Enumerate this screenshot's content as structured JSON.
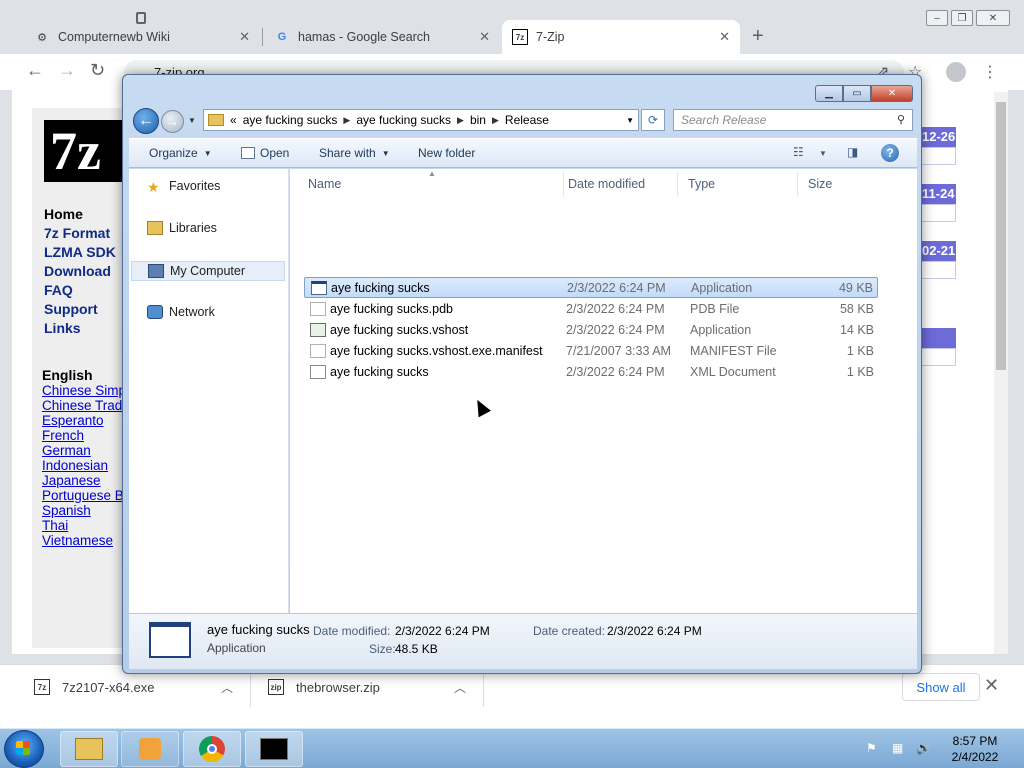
{
  "chrome": {
    "tabs": [
      {
        "label": "Computernewb Wiki",
        "icon": "puzzle-icon"
      },
      {
        "label": "hamas - Google Search",
        "icon": "google-icon"
      },
      {
        "label": "7-Zip",
        "icon": "7zip-icon"
      }
    ],
    "url": "7-zip.org",
    "window_buttons": {
      "minimize": "–",
      "maximize": "❐",
      "close": "✕"
    }
  },
  "site": {
    "logo": "7z",
    "nav": [
      "Home",
      "7z Format",
      "LZMA SDK",
      "Download",
      "FAQ",
      "Support",
      "Links"
    ],
    "language_heading": "English",
    "languages": [
      "Chinese Simp",
      "Chinese Trad",
      "Esperanto",
      "French",
      "German",
      "Indonesian",
      "Japanese",
      "Portuguese Br",
      "Spanish",
      "Thai",
      "Vietnamese"
    ],
    "date_badges": [
      "12-26",
      "11-24",
      "02-21"
    ]
  },
  "downloads": {
    "items": [
      {
        "name": "7z2107-x64.exe"
      },
      {
        "name": "thebrowser.zip"
      }
    ],
    "show_all": "Show all"
  },
  "explorer": {
    "breadcrumb": [
      "«",
      "aye fucking sucks",
      "aye fucking sucks",
      "bin",
      "Release"
    ],
    "search_placeholder": "Search Release",
    "commands": {
      "organize": "Organize",
      "open": "Open",
      "share_with": "Share with",
      "new_folder": "New folder"
    },
    "nav": [
      {
        "label": "Favorites",
        "icon": "star-icon"
      },
      {
        "label": "Libraries",
        "icon": "libraries-icon"
      },
      {
        "label": "My Computer",
        "icon": "computer-icon"
      },
      {
        "label": "Network",
        "icon": "network-icon"
      }
    ],
    "columns": {
      "name": "Name",
      "date": "Date modified",
      "type": "Type",
      "size": "Size"
    },
    "files": [
      {
        "name": "aye fucking sucks",
        "date": "2/3/2022 6:24 PM",
        "type": "Application",
        "size": "49 KB",
        "selected": true
      },
      {
        "name": "aye fucking sucks.pdb",
        "date": "2/3/2022 6:24 PM",
        "type": "PDB File",
        "size": "58 KB"
      },
      {
        "name": "aye fucking sucks.vshost",
        "date": "2/3/2022 6:24 PM",
        "type": "Application",
        "size": "14 KB"
      },
      {
        "name": "aye fucking sucks.vshost.exe.manifest",
        "date": "7/21/2007 3:33 AM",
        "type": "MANIFEST File",
        "size": "1 KB"
      },
      {
        "name": "aye fucking sucks",
        "date": "2/3/2022 6:24 PM",
        "type": "XML Document",
        "size": "1 KB"
      }
    ],
    "details": {
      "name": "aye fucking sucks",
      "type": "Application",
      "date_modified_label": "Date modified:",
      "date_modified": "2/3/2022 6:24 PM",
      "date_created_label": "Date created:",
      "date_created": "2/3/2022 6:24 PM",
      "size_label": "Size:",
      "size": "48.5 KB"
    }
  },
  "taskbar": {
    "time": "8:57 PM",
    "date": "2/4/2022"
  }
}
